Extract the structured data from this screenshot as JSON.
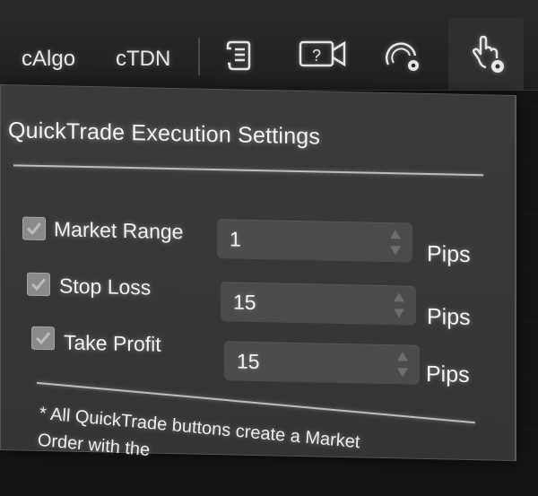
{
  "toolbar": {
    "links": [
      "cAlgo",
      "cTDN"
    ],
    "icons": [
      "document-scroll-icon",
      "video-help-icon",
      "gauge-settings-icon",
      "hand-settings-icon"
    ]
  },
  "panel": {
    "title": "QuickTrade Execution Settings",
    "rows": [
      {
        "label": "Market Range",
        "checked": true,
        "value": "1",
        "unit": "Pips"
      },
      {
        "label": "Stop Loss",
        "checked": true,
        "value": "15",
        "unit": "Pips"
      },
      {
        "label": "Take Profit",
        "checked": true,
        "value": "15",
        "unit": "Pips"
      }
    ],
    "footnote": {
      "line1": "* All QuickTrade buttons create a Market",
      "line2": "Order with the"
    }
  }
}
